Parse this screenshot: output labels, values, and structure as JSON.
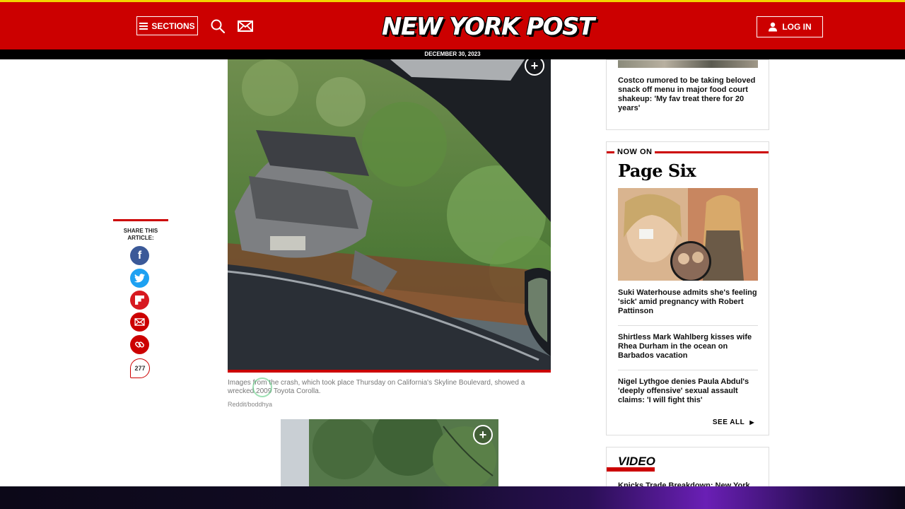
{
  "header": {
    "sections_label": "SECTIONS",
    "logo_text": "NEW YORK POST",
    "login_label": "LOG IN",
    "date": "DECEMBER 30, 2023",
    "search_icon": "search-icon",
    "mail_icon": "mail-icon"
  },
  "share": {
    "title": "SHARE THIS ARTICLE:",
    "buttons": [
      {
        "icon": "facebook-icon",
        "glyph": "f"
      },
      {
        "icon": "twitter-icon",
        "glyph": ""
      },
      {
        "icon": "flipboard-icon",
        "glyph": ""
      },
      {
        "icon": "email-icon",
        "glyph": ""
      },
      {
        "icon": "link-icon",
        "glyph": ""
      }
    ],
    "comment_count": "277"
  },
  "article": {
    "photo1_expand": "+",
    "caption": "Images from the crash, which took place Thursday on California's Skyline Boulevard, showed a wrecked 2009 Toyota Corolla.",
    "credit": "Reddit/boddhya",
    "photo2_expand": "+"
  },
  "sidebar": {
    "top_story": "Costco rumored to be taking beloved snack off menu in major food court shakeup: 'My fav treat there for 20 years'",
    "now_on_label": "NOW ON",
    "page_six_title": "Page Six",
    "stories": [
      "Suki Waterhouse admits she's feeling 'sick' amid pregnancy with Robert Pattinson",
      "Shirtless Mark Wahlberg kisses wife Rhea Durham in the ocean on Barbados vacation",
      "Nigel Lythgoe denies Paula Abdul's 'deeply offensive' sexual assault claims: 'I will fight this'"
    ],
    "see_all_label": "SEE ALL",
    "video_title": "VIDEO",
    "video_headline": "Knicks Trade Breakdown: New York"
  },
  "colors": {
    "brand_red": "#cc0000",
    "accent_yellow": "#f2d400"
  }
}
